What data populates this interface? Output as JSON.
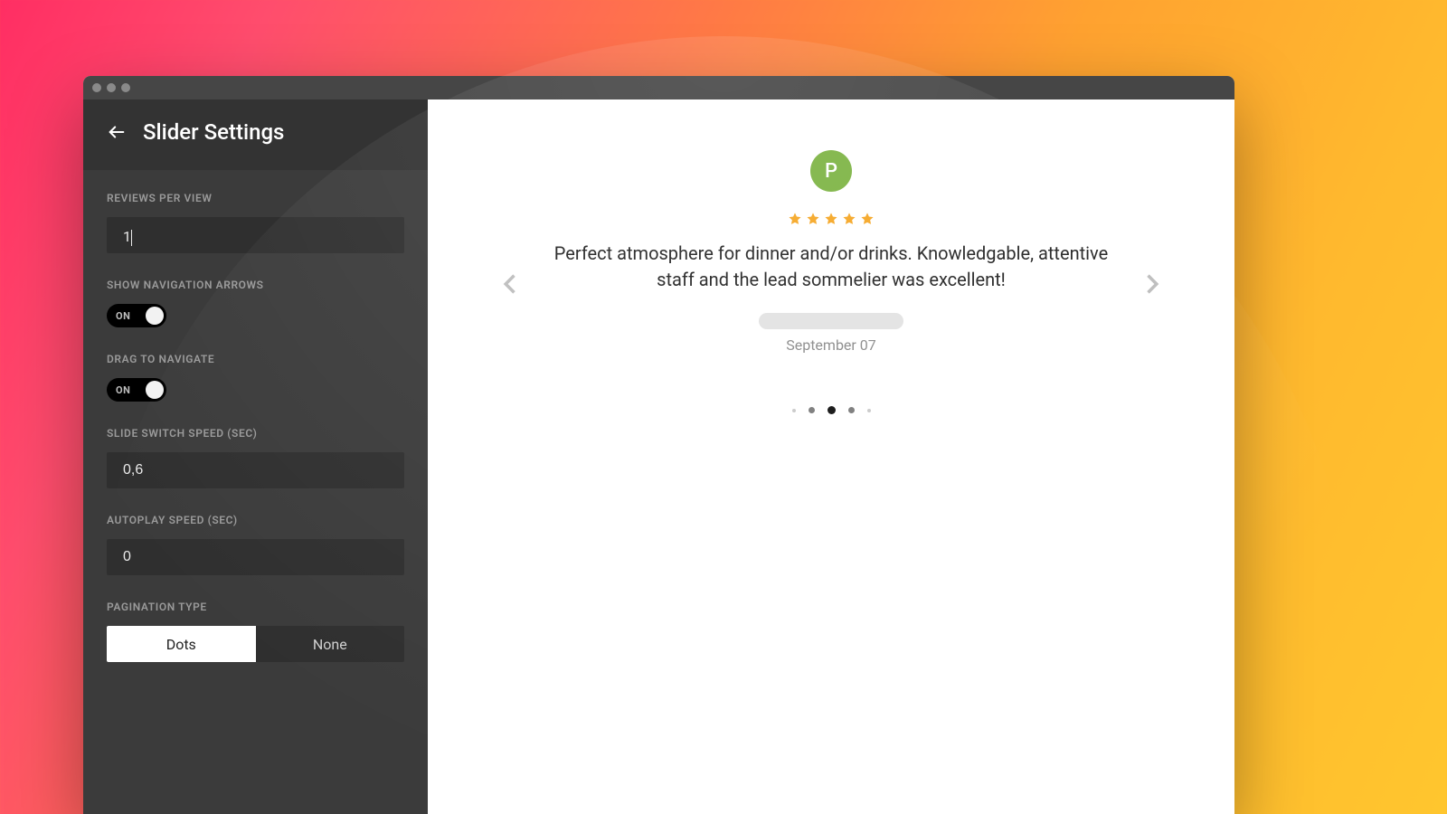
{
  "header": {
    "title": "Slider Settings"
  },
  "fields": {
    "reviews_per_view": {
      "label": "REVIEWS PER VIEW",
      "value": "1"
    },
    "show_nav_arrows": {
      "label": "SHOW NAVIGATION ARROWS",
      "state": "ON"
    },
    "drag_to_navigate": {
      "label": "DRAG TO NAVIGATE",
      "state": "ON"
    },
    "slide_switch_speed": {
      "label": "SLIDE SWITCH SPEED (SEC)",
      "value": "0,6"
    },
    "autoplay_speed": {
      "label": "AUTOPLAY SPEED (SEC)",
      "value": "0"
    },
    "pagination_type": {
      "label": "PAGINATION TYPE",
      "options": [
        "Dots",
        "None"
      ],
      "selected": "Dots"
    }
  },
  "preview": {
    "avatar_initial": "P",
    "star_rating": 5,
    "review_text": "Perfect atmosphere for dinner and/or drinks. Knowledgable, attentive staff and the lead sommelier was excellent!",
    "date": "September 07",
    "pagination_total": 5,
    "pagination_active_index": 2
  },
  "colors": {
    "avatar_bg": "#7cb342",
    "star_fill": "#f5a623"
  }
}
